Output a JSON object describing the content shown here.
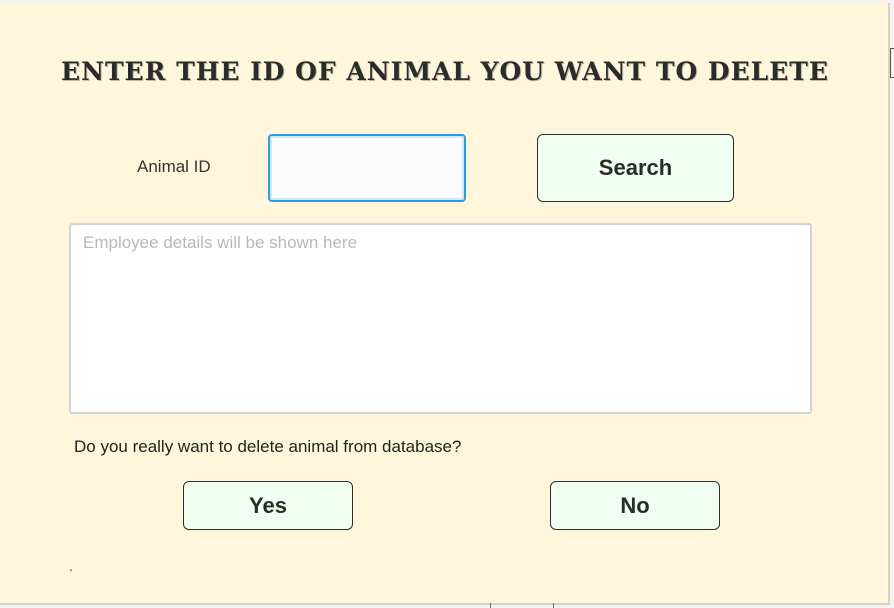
{
  "dialog": {
    "title": "ENTER THE ID OF ANIMAL YOU WANT TO DELETE",
    "animal_id_label": "Animal ID",
    "animal_id_value": "",
    "search_label": "Search",
    "details_placeholder": "Employee details will be shown here",
    "confirm_question": "Do you really want to delete animal from database?",
    "yes_label": "Yes",
    "no_label": "No",
    "status_text": "."
  },
  "colors": {
    "background": "#fff6dc",
    "button_background": "#f0fff2",
    "input_focus_border": "#2a9fe0"
  }
}
